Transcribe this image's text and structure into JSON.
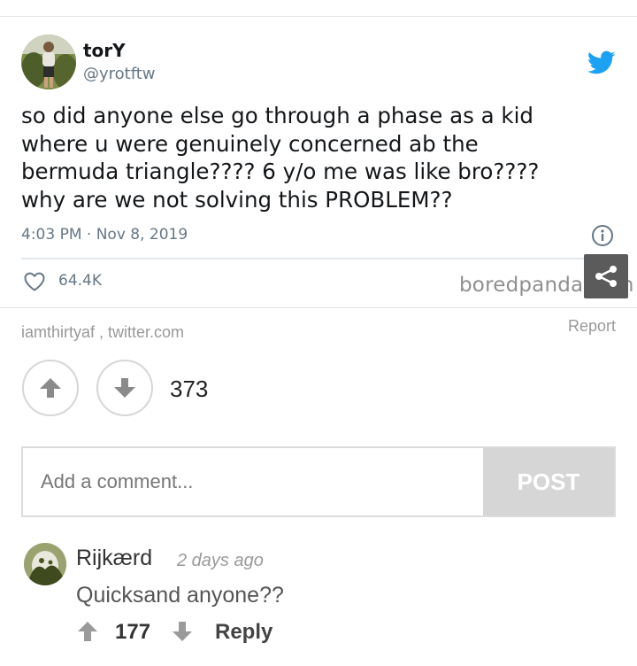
{
  "tweet": {
    "name": "torY",
    "handle": "@yrotftw",
    "text": "so did anyone else go through a phase as a kid\nwhere u were genuinely concerned ab the\nbermuda triangle???? 6 y/o me was like bro????\nwhy are we not solving this PROBLEM??",
    "timestamp": "4:03 PM · Nov 8, 2019",
    "likes": "64.4K",
    "watermark": "boredpanda.com",
    "icons": [
      "twitter-bird-icon",
      "info-icon",
      "heart-icon",
      "share-icon"
    ],
    "accent_color": "#1da1f2"
  },
  "source": {
    "text": "iamthirtyaf , twitter.com",
    "report_label": "Report"
  },
  "votes": {
    "score": "373"
  },
  "comment_form": {
    "placeholder": "Add a comment...",
    "post_label": "POST"
  },
  "comments": [
    {
      "author": "Rijkærd",
      "time": "2 days ago",
      "text": "Quicksand anyone??",
      "score": "177",
      "reply_label": "Reply"
    }
  ]
}
